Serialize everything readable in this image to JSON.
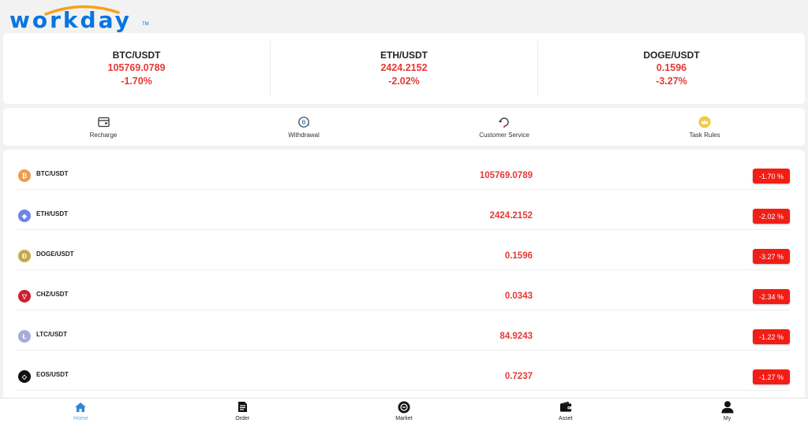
{
  "brand": {
    "logo_text": "workday",
    "logo_tm": "TM",
    "accent": "#0875e1",
    "arc_color": "#f4a21b"
  },
  "colors": {
    "negative": "#e53935",
    "badge_bg": "#f21d16",
    "active_nav": "#2f86d6"
  },
  "tickers": [
    {
      "pair": "BTC/USDT",
      "price": "105769.0789",
      "change": "-1.70%"
    },
    {
      "pair": "ETH/USDT",
      "price": "2424.2152",
      "change": "-2.02%"
    },
    {
      "pair": "DOGE/USDT",
      "price": "0.1596",
      "change": "-3.27%"
    }
  ],
  "menu": [
    {
      "label": "Recharge",
      "icon": "wallet-card-icon"
    },
    {
      "label": "Withdrawal",
      "icon": "withdraw-coin-icon"
    },
    {
      "label": "Customer Service",
      "icon": "customer-service-icon"
    },
    {
      "label": "Task Rules",
      "icon": "crown-icon"
    }
  ],
  "markets": [
    {
      "pair": "BTC/USDT",
      "price": "105769.0789",
      "change": "-1.70 %",
      "icon": "btc-icon",
      "icon_color": "#f29a4a",
      "glyph": "₿"
    },
    {
      "pair": "ETH/USDT",
      "price": "2424.2152",
      "change": "-2.02 %",
      "icon": "eth-icon",
      "icon_color": "#6e84e6",
      "glyph": "◆"
    },
    {
      "pair": "DOGE/USDT",
      "price": "0.1596",
      "change": "-3.27 %",
      "icon": "doge-icon",
      "icon_color": "#c7a94a",
      "glyph": "Ð"
    },
    {
      "pair": "CHZ/USDT",
      "price": "0.0343",
      "change": "-2.34 %",
      "icon": "chz-icon",
      "icon_color": "#cc1f2d",
      "glyph": "▽"
    },
    {
      "pair": "LTC/USDT",
      "price": "84.9243",
      "change": "-1.22 %",
      "icon": "ltc-icon",
      "icon_color": "#a7acd6",
      "glyph": "Ł"
    },
    {
      "pair": "EOS/USDT",
      "price": "0.7237",
      "change": "-1.27 %",
      "icon": "eos-icon",
      "icon_color": "#111111",
      "glyph": "◇"
    }
  ],
  "nav": [
    {
      "label": "Home",
      "icon": "home-icon",
      "active": true
    },
    {
      "label": "Order",
      "icon": "document-icon",
      "active": false
    },
    {
      "label": "Market",
      "icon": "market-icon",
      "active": false
    },
    {
      "label": "Asset",
      "icon": "wallet-icon",
      "active": false
    },
    {
      "label": "My",
      "icon": "user-icon",
      "active": false
    }
  ]
}
